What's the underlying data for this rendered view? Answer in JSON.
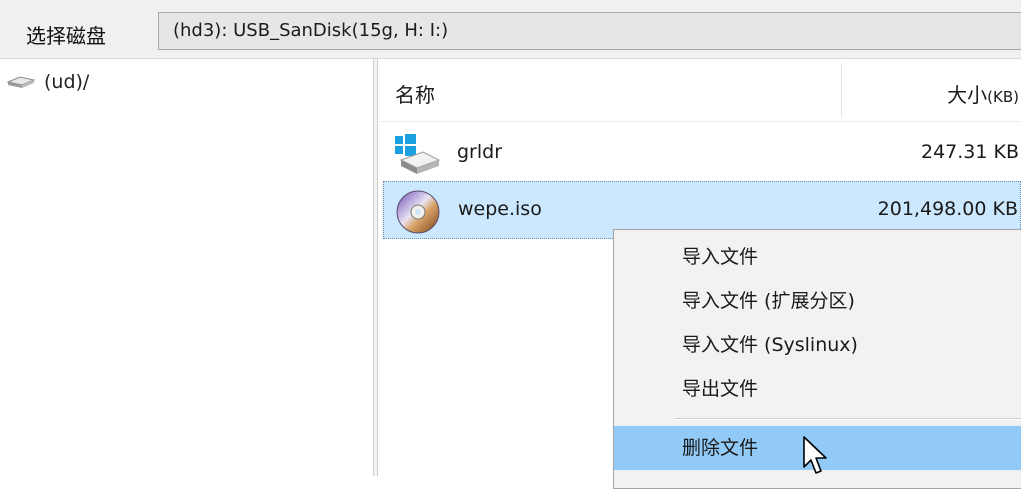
{
  "toolbar": {
    "select_label": "选择磁盘",
    "disk_value": "(hd3): USB_SanDisk(15g, H: I:)"
  },
  "tree": {
    "items": [
      {
        "label": "(ud)/",
        "icon": "drive-icon"
      }
    ]
  },
  "file_list": {
    "columns": {
      "name": "名称",
      "size_main": "大小",
      "size_unit": "(KB)"
    },
    "rows": [
      {
        "name": "grldr",
        "size": "247.31 KB",
        "icon": "windows-drive-icon",
        "selected": false
      },
      {
        "name": "wepe.iso",
        "size": "201,498.00 KB",
        "icon": "disc-icon",
        "selected": true
      }
    ]
  },
  "context_menu": {
    "items": [
      {
        "label": "导入文件"
      },
      {
        "label": "导入文件 (扩展分区)"
      },
      {
        "label": "导入文件 (Syslinux)"
      },
      {
        "label": "导出文件"
      },
      {
        "label": "删除文件",
        "highlighted": true
      }
    ]
  },
  "colors": {
    "selection": "#cce8ff",
    "menu_highlight": "#91c9f7",
    "menu_background": "#f2f2f2"
  }
}
